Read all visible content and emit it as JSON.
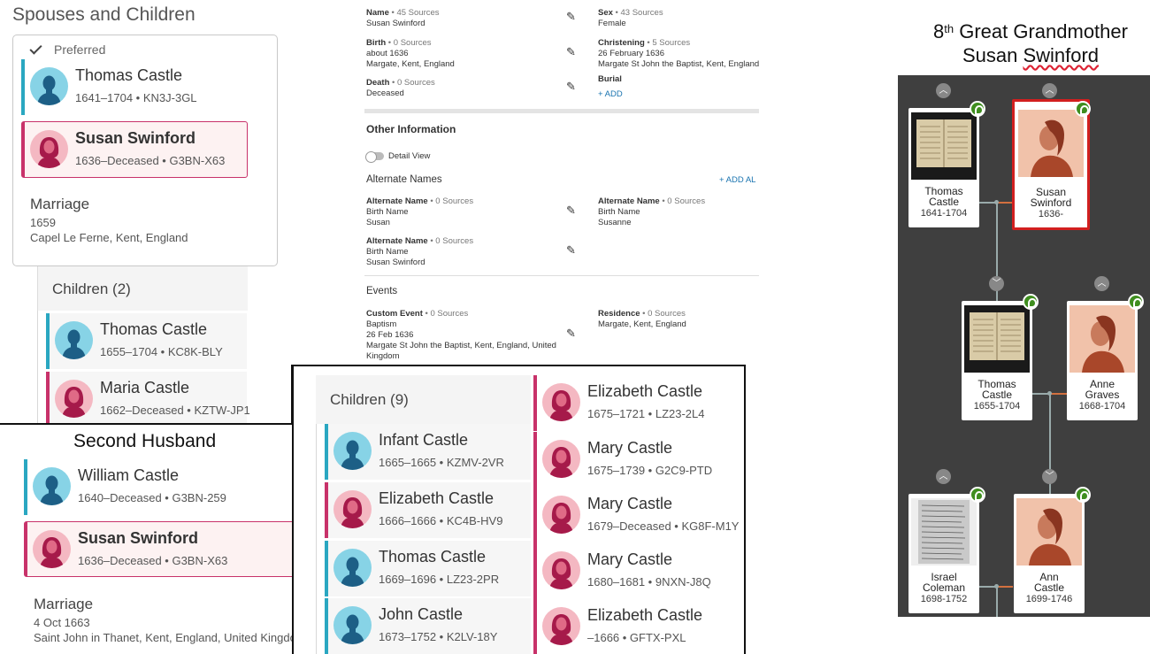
{
  "spouses": {
    "title": "Spouses and Children",
    "preferred_label": "Preferred",
    "husband": {
      "name": "Thomas Castle",
      "meta": "1641–1704 •  KN3J-3GL"
    },
    "wife": {
      "name": "Susan Swinford",
      "meta": "1636–Deceased •  G3BN-X63"
    },
    "marriage": {
      "label": "Marriage",
      "date": "1659",
      "place": "Capel Le Ferne, Kent, England"
    },
    "children_header": "Children (2)",
    "children": [
      {
        "name": "Thomas Castle",
        "meta": "1655–1704 •  KC8K-BLY"
      },
      {
        "name": "Maria Castle",
        "meta": "1662–Deceased •  KZTW-JP1"
      }
    ]
  },
  "second": {
    "title": "Second Husband",
    "husband": {
      "name": "William Castle",
      "meta": "1640–Deceased •  G3BN-259"
    },
    "wife": {
      "name": "Susan Swinford",
      "meta": "1636–Deceased •  G3BN-X63"
    },
    "marriage": {
      "label": "Marriage",
      "date": "4 Oct 1663",
      "place": "Saint John in Thanet, Kent, England, United Kingdom"
    },
    "children_header": "Children (9)",
    "children_left": [
      {
        "name": "Infant Castle",
        "meta": "1665–1665 •  KZMV-2VR"
      },
      {
        "name": "Elizabeth Castle",
        "meta": "1666–1666 •  KC4B-HV9"
      },
      {
        "name": "Thomas Castle",
        "meta": "1669–1696 •  LZ23-2PR"
      },
      {
        "name": "John Castle",
        "meta": "1673–1752 •  K2LV-18Y"
      }
    ],
    "children_right": [
      {
        "name": "Elizabeth Castle",
        "meta": "1675–1721 •  LZ23-2L4"
      },
      {
        "name": "Mary Castle",
        "meta": "1675–1739 •  G2C9-PTD"
      },
      {
        "name": "Mary Castle",
        "meta": "1679–Deceased •  KG8F-M1Y"
      },
      {
        "name": "Mary Castle",
        "meta": "1680–1681 •  9NXN-J8Q"
      },
      {
        "name": "Elizabeth Castle",
        "meta": "–1666 •  GFTX-PXL"
      }
    ]
  },
  "details": {
    "name": {
      "label": "Name",
      "src": " • 45 Sources",
      "val": "Susan Swinford"
    },
    "sex": {
      "label": "Sex",
      "src": " • 43 Sources",
      "val": "Female"
    },
    "birth": {
      "label": "Birth",
      "src": " • 0 Sources",
      "val1": "about 1636",
      "val2": "Margate, Kent, England"
    },
    "christening": {
      "label": "Christening",
      "src": " • 5 Sources",
      "val1": "26 February 1636",
      "val2": "Margate St John the Baptist, Kent, England"
    },
    "death": {
      "label": "Death",
      "src": " • 0 Sources",
      "val": "Deceased"
    },
    "burial": {
      "label": "Burial",
      "add": "+  ADD"
    },
    "other_info": "Other Information",
    "detail_view": "Detail View",
    "alt_names": "Alternate Names",
    "add_alt": "+  ADD AL",
    "alt1": {
      "label": "Alternate Name",
      "src": " • 0 Sources",
      "type": "Birth Name",
      "val": "Susan"
    },
    "alt2": {
      "label": "Alternate Name",
      "src": " • 0 Sources",
      "type": "Birth Name",
      "val": "Susanne"
    },
    "alt3": {
      "label": "Alternate Name",
      "src": " • 0 Sources",
      "type": "Birth Name",
      "val": "Susan Swinford"
    },
    "events": "Events",
    "custom": {
      "label": "Custom Event",
      "src": " • 0 Sources",
      "v1": "Baptism",
      "v2": "26 Feb 1636",
      "v3": "Margate St John the Baptist, Kent, England, United",
      "v4": "Kingdom"
    },
    "residence": {
      "label": "Residence",
      "src": " • 0 Sources",
      "val": "Margate, Kent, England"
    }
  },
  "tree": {
    "title_pre": "8",
    "title_sup": "th",
    "title_rest": " Great Grandmother",
    "title_name_first": "Susan ",
    "title_name_last": "Swinford",
    "cards": [
      {
        "name1": "Thomas",
        "name2": "Castle",
        "dates": "1641-1704"
      },
      {
        "name1": "Susan",
        "name2": "Swinford",
        "dates": "1636-"
      },
      {
        "name1": "Thomas",
        "name2": "Castle",
        "dates": "1655-1704"
      },
      {
        "name1": "Anne",
        "name2": "Graves",
        "dates": "1668-1704"
      },
      {
        "name1": "Israel",
        "name2": "Coleman",
        "dates": "1698-1752"
      },
      {
        "name1": "Ann",
        "name2": "Castle",
        "dates": "1699-1746"
      }
    ]
  },
  "colors": {
    "male": "#2aa7c1",
    "female": "#c8326a",
    "selected": "#d21f1f",
    "tree_bg": "#3f3f3f"
  }
}
